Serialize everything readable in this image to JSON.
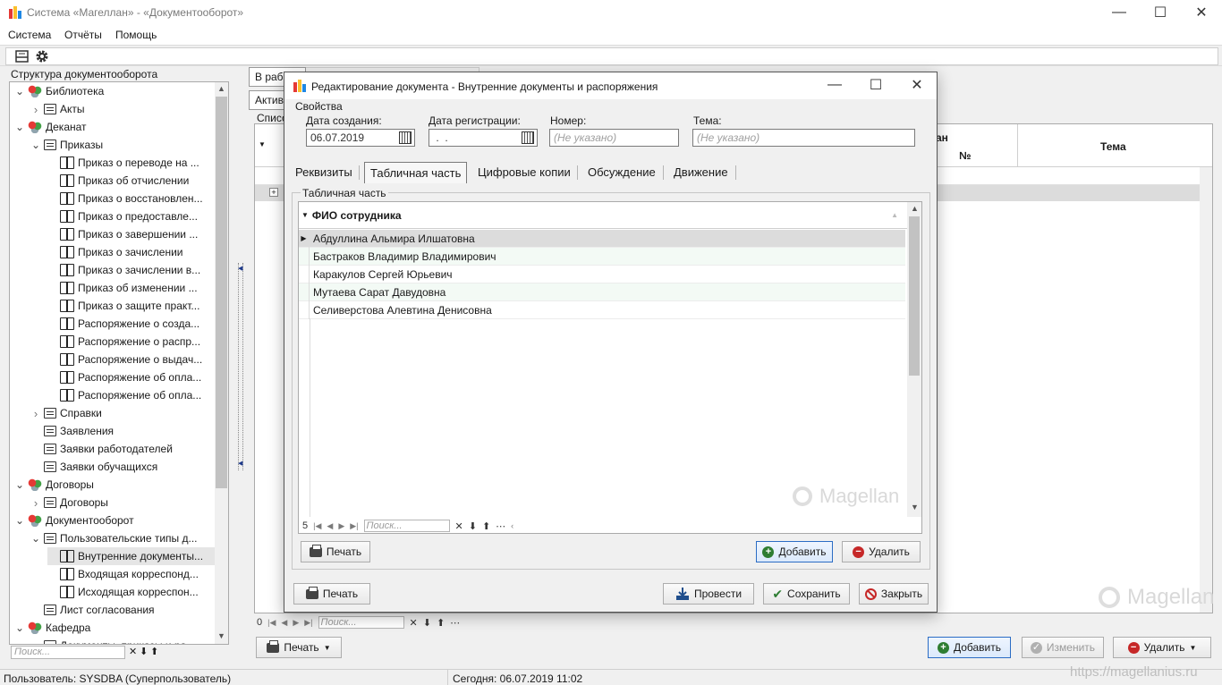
{
  "window": {
    "title": "Система «Магеллан» - «Документооборот»",
    "minimize": "—",
    "maximize": "☐",
    "close": "✕"
  },
  "menu": {
    "items": [
      "Система",
      "Отчёты",
      "Помощь"
    ]
  },
  "left_panel": {
    "header": "Структура документооборота",
    "search_placeholder": "Поиск...",
    "tree": [
      {
        "label": "Библиотека",
        "level": 0,
        "icon": "library-icon",
        "expander": "expanded"
      },
      {
        "label": "Акты",
        "level": 1,
        "icon": "folder-icon",
        "expander": "collapsed"
      },
      {
        "label": "Деканат",
        "level": 0,
        "icon": "library-icon",
        "expander": "expanded"
      },
      {
        "label": "Приказы",
        "level": 1,
        "icon": "folder-icon",
        "expander": "expanded"
      },
      {
        "label": "Приказ о переводе на ...",
        "level": 2,
        "icon": "book-icon",
        "expander": "none"
      },
      {
        "label": "Приказ об отчислении",
        "level": 2,
        "icon": "book-icon",
        "expander": "none"
      },
      {
        "label": "Приказ о восстановлен...",
        "level": 2,
        "icon": "book-icon",
        "expander": "none"
      },
      {
        "label": "Приказ о предоставле...",
        "level": 2,
        "icon": "book-icon",
        "expander": "none"
      },
      {
        "label": "Приказ о завершении ...",
        "level": 2,
        "icon": "book-icon",
        "expander": "none"
      },
      {
        "label": "Приказ о зачислении",
        "level": 2,
        "icon": "book-icon",
        "expander": "none"
      },
      {
        "label": "Приказ о зачислении в...",
        "level": 2,
        "icon": "book-icon",
        "expander": "none"
      },
      {
        "label": "Приказ об изменении ...",
        "level": 2,
        "icon": "book-icon",
        "expander": "none"
      },
      {
        "label": "Приказ о защите практ...",
        "level": 2,
        "icon": "book-icon",
        "expander": "none"
      },
      {
        "label": "Распоряжение о созда...",
        "level": 2,
        "icon": "book-icon",
        "expander": "none"
      },
      {
        "label": "Распоряжение о распр...",
        "level": 2,
        "icon": "book-icon",
        "expander": "none"
      },
      {
        "label": "Распоряжение о выдач...",
        "level": 2,
        "icon": "book-icon",
        "expander": "none"
      },
      {
        "label": "Распоряжение об опла...",
        "level": 2,
        "icon": "book-icon",
        "expander": "none"
      },
      {
        "label": "Распоряжение об опла...",
        "level": 2,
        "icon": "book-icon",
        "expander": "none"
      },
      {
        "label": "Справки",
        "level": 1,
        "icon": "folder-icon",
        "expander": "collapsed"
      },
      {
        "label": "Заявления",
        "level": 1,
        "icon": "folder-icon",
        "expander": "none"
      },
      {
        "label": "Заявки работодателей",
        "level": 1,
        "icon": "folder-icon",
        "expander": "none"
      },
      {
        "label": "Заявки обучащихся",
        "level": 1,
        "icon": "folder-icon",
        "expander": "none"
      },
      {
        "label": "Договоры",
        "level": 0,
        "icon": "library-icon",
        "expander": "expanded"
      },
      {
        "label": "Договоры",
        "level": 1,
        "icon": "folder-icon",
        "expander": "collapsed"
      },
      {
        "label": "Документооборот",
        "level": 0,
        "icon": "library-icon",
        "expander": "expanded"
      },
      {
        "label": "Пользовательские типы д...",
        "level": 1,
        "icon": "folder-icon",
        "expander": "expanded"
      },
      {
        "label": "Внутренние документы...",
        "level": 2,
        "icon": "book-icon",
        "expander": "none",
        "selected": true
      },
      {
        "label": "Входящая корреспонд...",
        "level": 2,
        "icon": "book-icon",
        "expander": "none"
      },
      {
        "label": "Исходящая корреспон...",
        "level": 2,
        "icon": "book-icon",
        "expander": "none"
      },
      {
        "label": "Лист согласования",
        "level": 1,
        "icon": "folder-icon",
        "expander": "none"
      },
      {
        "label": "Кафедра",
        "level": 0,
        "icon": "library-icon",
        "expander": "expanded"
      },
      {
        "label": "Документы, приказы и ра...",
        "level": 1,
        "icon": "folder-icon",
        "expander": "none"
      }
    ]
  },
  "main": {
    "tabs_top": [
      "В раб"
    ],
    "tabs_second": [
      "Актив"
    ],
    "list_label": "Списо",
    "columns": {
      "col_an": "ан",
      "col_num": "№",
      "col_tema": "Тема"
    },
    "nav_count": "0",
    "nav_search_placeholder": "Поиск...",
    "print_label": "Печать",
    "add_label": "Добавить",
    "edit_label": "Изменить",
    "delete_label": "Удалить",
    "watermark": "Magellan"
  },
  "dialog": {
    "title": "Редактирование документа - Внутренние документы и распоряжения",
    "properties_label": "Свойства",
    "fields": {
      "created_label": "Дата создания:",
      "created_value": "06.07.2019",
      "registered_label": "Дата регистрации:",
      "registered_value": " .  .",
      "number_label": "Номер:",
      "number_placeholder": "(Не указано)",
      "topic_label": "Тема:",
      "topic_placeholder": "(Не указано)"
    },
    "tabs": [
      "Реквизиты",
      "Табличная часть",
      "Цифровые копии",
      "Обсуждение",
      "Движение"
    ],
    "active_tab": "Табличная часть",
    "table_section_label": "Табличная часть",
    "grid": {
      "column": "ФИО сотрудника",
      "rows": [
        "Абдуллина Альмира Илшатовна",
        "Бастраков Владимир Владимирович",
        "Каракулов Сергей Юрьевич",
        "Мутаева Сарат Давудовна",
        "Селиверстова Алевтина Денисовна"
      ],
      "count": "5",
      "search_placeholder": "Поиск..."
    },
    "inner_print": "Печать",
    "inner_add": "Добавить",
    "inner_delete": "Удалить",
    "footer_print": "Печать",
    "footer_post": "Провести",
    "footer_save": "Сохранить",
    "footer_close": "Закрыть",
    "watermark": "Magellan"
  },
  "status": {
    "user": "Пользователь: SYSDBA (Суперпользователь)",
    "today": "Сегодня: 06.07.2019 11:02",
    "url": "https://magellanius.ru"
  }
}
